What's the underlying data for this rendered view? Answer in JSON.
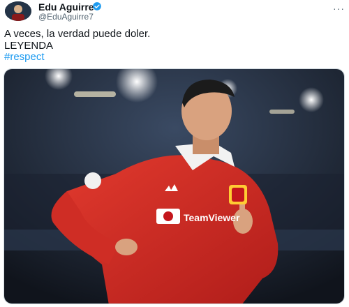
{
  "tweet": {
    "author_name": "Edu Aguirre",
    "handle": "@EduAguirre7",
    "text_lines": [
      "A veces, la verdad puede doler.",
      "LEYENDA",
      "#respect"
    ],
    "media": {
      "description_icon": "football-player-photo",
      "badge_text": "Team",
      "kit_text": "TeamViewer"
    }
  },
  "colors": {
    "verified_blue": "#1d9bf0",
    "hashtag_blue": "#1d9bf0",
    "kit_red": "#d42a24"
  }
}
